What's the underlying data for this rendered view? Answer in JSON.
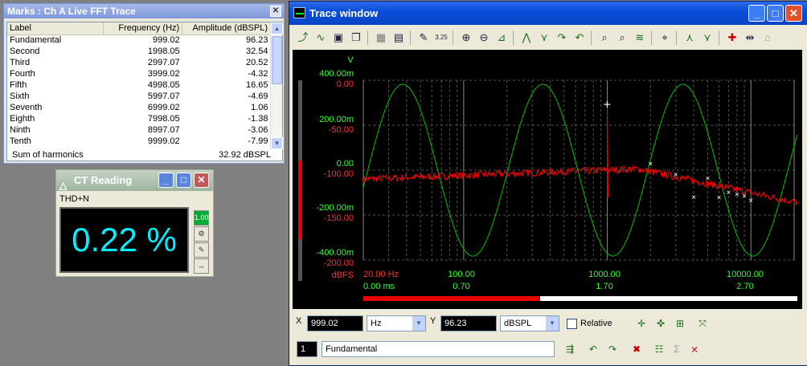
{
  "marks_window": {
    "title": "Marks : Ch A Live FFT Trace",
    "close": "✕",
    "columns": [
      "Label",
      "Frequency (Hz)",
      "Amplitude (dBSPL)"
    ],
    "rows": [
      {
        "label": "Fundamental",
        "freq": "999.02",
        "amp": "96.23"
      },
      {
        "label": "Second",
        "freq": "1998.05",
        "amp": "32.54"
      },
      {
        "label": "Third",
        "freq": "2997.07",
        "amp": "20.52"
      },
      {
        "label": "Fourth",
        "freq": "3999.02",
        "amp": "-4.32"
      },
      {
        "label": "Fifth",
        "freq": "4998.05",
        "amp": "16.65"
      },
      {
        "label": "Sixth",
        "freq": "5997.07",
        "amp": "-4.69"
      },
      {
        "label": "Seventh",
        "freq": "6999.02",
        "amp": "1.06"
      },
      {
        "label": "Eighth",
        "freq": "7998.05",
        "amp": "-1.38"
      },
      {
        "label": "Ninth",
        "freq": "8997.07",
        "amp": "-3.06"
      },
      {
        "label": "Tenth",
        "freq": "9999.02",
        "amp": "-7.99"
      }
    ],
    "sum_label": "Sum of harmonics",
    "sum_value": "32.92 dBSPL"
  },
  "ct_window": {
    "title": "CT Reading",
    "measure_label": "THD+N",
    "reading": "0.22 %",
    "minimize": "_",
    "maximize": "□",
    "close": "✕",
    "side_btn_1": "1.00",
    "side_btn_4": "↔"
  },
  "trace_window": {
    "title": "Trace window",
    "minimize": "_",
    "maximize": "□",
    "close": "✕",
    "plot": {
      "left_axis_unit": "V",
      "left_ticks_v": [
        "400.00m",
        "200.00m",
        "0.00",
        "-200.00m",
        "-400.00m"
      ],
      "left_ticks_db": [
        "0.00",
        "-50.00",
        "-100.00",
        "-150.00",
        "-200.00"
      ],
      "db_unit": "dBFS",
      "x_ticks_hz": [
        "20.00 Hz",
        "100.00",
        "1000.00",
        "10000.00"
      ],
      "x_ticks_time": [
        "0.00 ms",
        "0.70",
        "1.70",
        "2.70"
      ]
    },
    "cursor_x_label": "X",
    "cursor_x_value": "999.02",
    "cursor_x_unit": "Hz",
    "cursor_y_label": "Y",
    "cursor_y_value": "96.23",
    "cursor_y_unit": "dBSPL",
    "relative_label": "Relative",
    "mark_index": "1",
    "mark_name": "Fundamental"
  },
  "colors": {
    "fft_trace": "#FF0000",
    "time_trace": "#00C000",
    "db_axis": "#FF3030",
    "volt_axis": "#30FF30",
    "reading": "#00F0FF"
  }
}
